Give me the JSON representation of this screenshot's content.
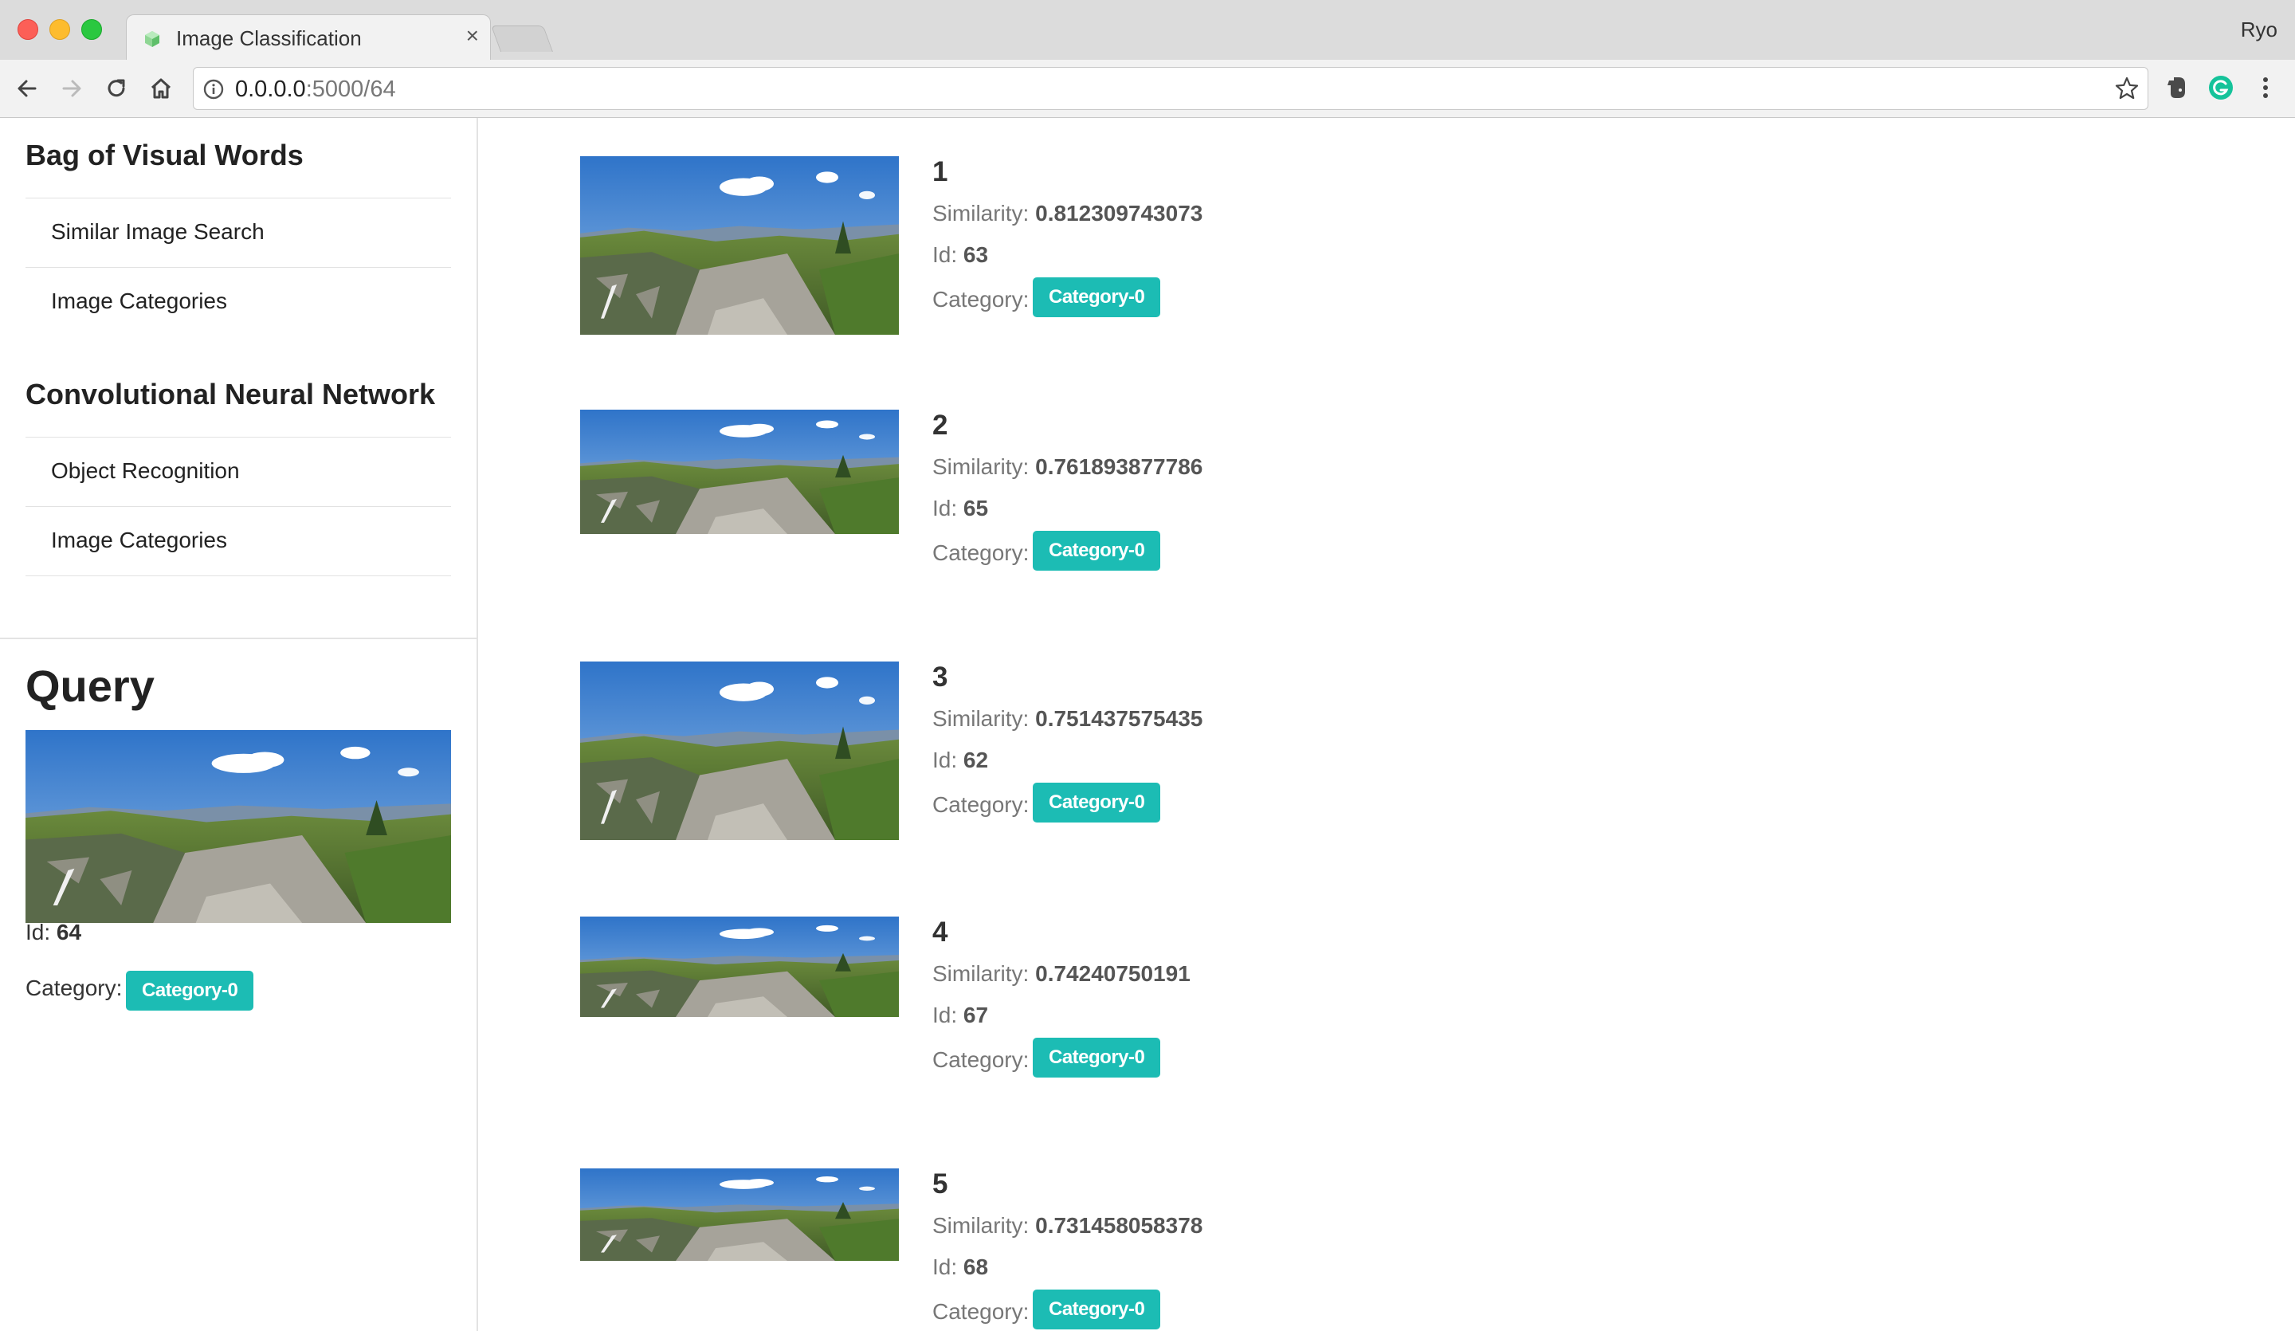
{
  "browser": {
    "tab_title": "Image Classification",
    "tab_close": "×",
    "profile_name": "Ryo",
    "url_host": "0.0.0.0",
    "url_rest": ":5000/64"
  },
  "sidebar": {
    "sections": [
      {
        "title": "Bag of Visual Words",
        "items": [
          "Similar Image Search",
          "Image Categories"
        ]
      },
      {
        "title": "Convolutional Neural Network",
        "items": [
          "Object Recognition",
          "Image Categories"
        ]
      }
    ]
  },
  "query": {
    "title": "Query",
    "id_label": "Id:",
    "id_value": "64",
    "category_label": "Category:",
    "category_value": "Category-0"
  },
  "results": [
    {
      "rank": "1",
      "similarity_label": "Similarity:",
      "similarity": "0.812309743073",
      "id_label": "Id:",
      "id": "63",
      "category_label": "Category:",
      "category": "Category-0"
    },
    {
      "rank": "2",
      "similarity_label": "Similarity:",
      "similarity": "0.761893877786",
      "id_label": "Id:",
      "id": "65",
      "category_label": "Category:",
      "category": "Category-0"
    },
    {
      "rank": "3",
      "similarity_label": "Similarity:",
      "similarity": "0.751437575435",
      "id_label": "Id:",
      "id": "62",
      "category_label": "Category:",
      "category": "Category-0"
    },
    {
      "rank": "4",
      "similarity_label": "Similarity:",
      "similarity": "0.74240750191",
      "id_label": "Id:",
      "id": "67",
      "category_label": "Category:",
      "category": "Category-0"
    },
    {
      "rank": "5",
      "similarity_label": "Similarity:",
      "similarity": "0.731458058378",
      "id_label": "Id:",
      "id": "68",
      "category_label": "Category:",
      "category": "Category-0"
    }
  ],
  "colors": {
    "badge": "#1cbcb4",
    "titlebar": "#dcdcdc",
    "toolbar": "#f2f2f2"
  }
}
